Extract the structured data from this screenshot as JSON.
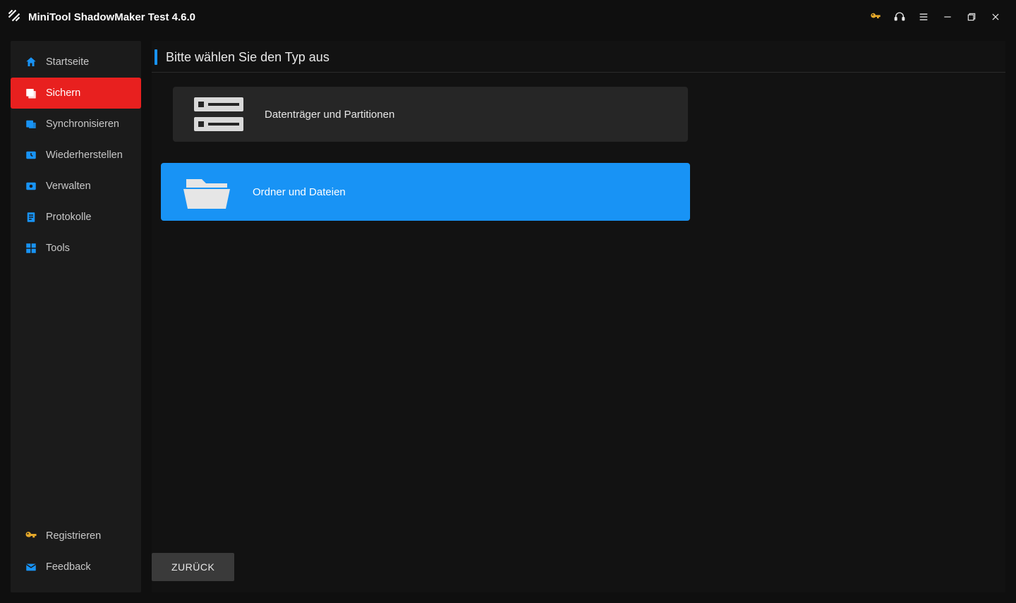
{
  "app": {
    "title": "MiniTool ShadowMaker Test 4.6.0"
  },
  "titlebar_icons": {
    "key": "key-icon",
    "headset": "headset-icon",
    "menu": "menu-icon",
    "minimize": "minimize-icon",
    "maximize": "maximize-icon",
    "close": "close-icon"
  },
  "sidebar": {
    "items": [
      {
        "label": "Startseite",
        "icon": "home-icon",
        "active": false
      },
      {
        "label": "Sichern",
        "icon": "backup-icon",
        "active": true
      },
      {
        "label": "Synchronisieren",
        "icon": "sync-icon",
        "active": false
      },
      {
        "label": "Wiederherstellen",
        "icon": "restore-icon",
        "active": false
      },
      {
        "label": "Verwalten",
        "icon": "manage-icon",
        "active": false
      },
      {
        "label": "Protokolle",
        "icon": "logs-icon",
        "active": false
      },
      {
        "label": "Tools",
        "icon": "tools-icon",
        "active": false
      }
    ],
    "bottom": [
      {
        "label": "Registrieren",
        "icon": "key-icon"
      },
      {
        "label": "Feedback",
        "icon": "mail-icon"
      }
    ]
  },
  "page": {
    "title": "Bitte wählen Sie den Typ aus",
    "options": [
      {
        "label": "Datenträger und Partitionen",
        "icon": "disk-icon",
        "selected": false
      },
      {
        "label": "Ordner und Dateien",
        "icon": "folder-icon",
        "selected": true
      }
    ],
    "back_label": "ZURÜCK"
  },
  "colors": {
    "accent_blue": "#1893f5",
    "accent_red": "#e8201f",
    "key_gold": "#e5a82a"
  }
}
